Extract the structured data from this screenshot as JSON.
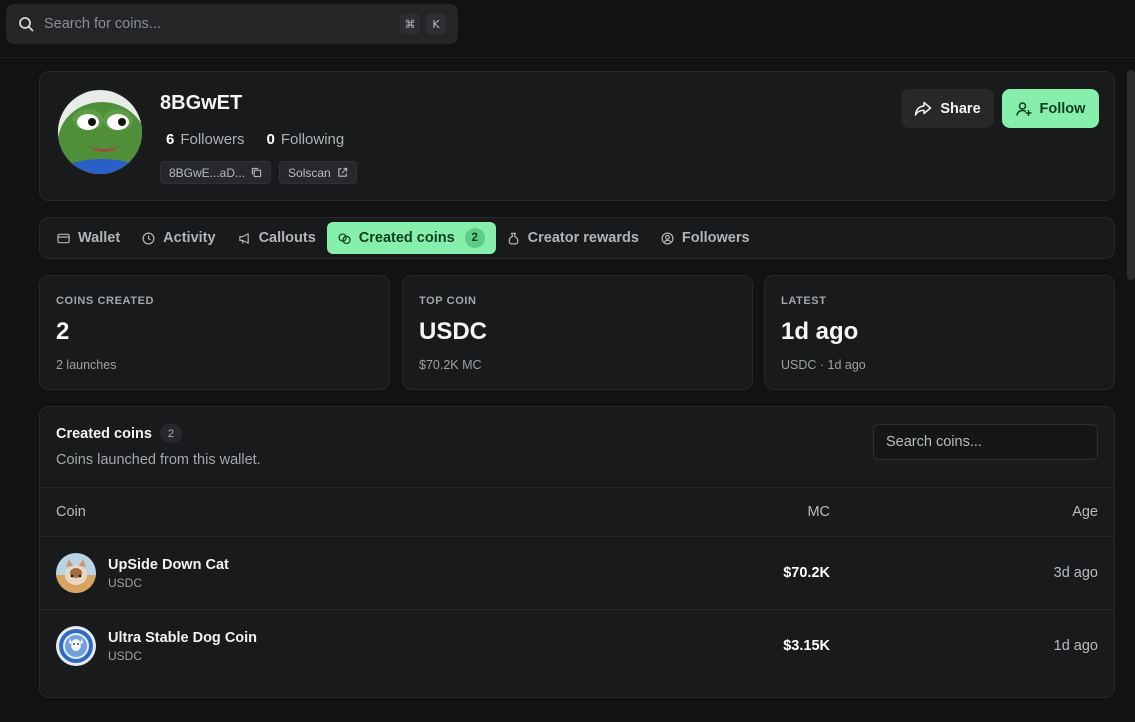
{
  "search": {
    "placeholder": "Search for coins...",
    "shortcut_cmd": "⌘",
    "shortcut_key": "K"
  },
  "profile": {
    "name": "8BGwET",
    "followers_count": "6",
    "followers_label": "Followers",
    "following_count": "0",
    "following_label": "Following",
    "address_short": "8BGwE...aD...",
    "solscan_label": "Solscan",
    "share_label": "Share",
    "follow_label": "Follow"
  },
  "tabs": [
    {
      "label": "Wallet",
      "icon": "wallet-icon"
    },
    {
      "label": "Activity",
      "icon": "clock-icon"
    },
    {
      "label": "Callouts",
      "icon": "megaphone-icon"
    },
    {
      "label": "Created coins",
      "icon": "coins-icon",
      "badge": "2",
      "active": true
    },
    {
      "label": "Creator rewards",
      "icon": "bag-icon"
    },
    {
      "label": "Followers",
      "icon": "user-circle-icon"
    }
  ],
  "stats": [
    {
      "label": "COINS CREATED",
      "value": "2",
      "sub": "2 launches"
    },
    {
      "label": "TOP COIN",
      "value": "USDC",
      "sub": "$70.2K MC"
    },
    {
      "label": "LATEST",
      "value": "1d ago",
      "sub": "USDC · 1d ago"
    }
  ],
  "created": {
    "title": "Created coins",
    "count": "2",
    "description": "Coins launched from this wallet.",
    "search_placeholder": "Search coins...",
    "columns": {
      "coin": "Coin",
      "mc": "MC",
      "age": "Age"
    },
    "rows": [
      {
        "name": "UpSide Down Cat",
        "symbol": "USDC",
        "mc": "$70.2K",
        "age": "3d ago"
      },
      {
        "name": "Ultra Stable Dog Coin",
        "symbol": "USDC",
        "mc": "$3.15K",
        "age": "1d ago"
      }
    ]
  },
  "colors": {
    "accent": "#86efac",
    "background": "#111213",
    "panel": "#181a1b"
  }
}
